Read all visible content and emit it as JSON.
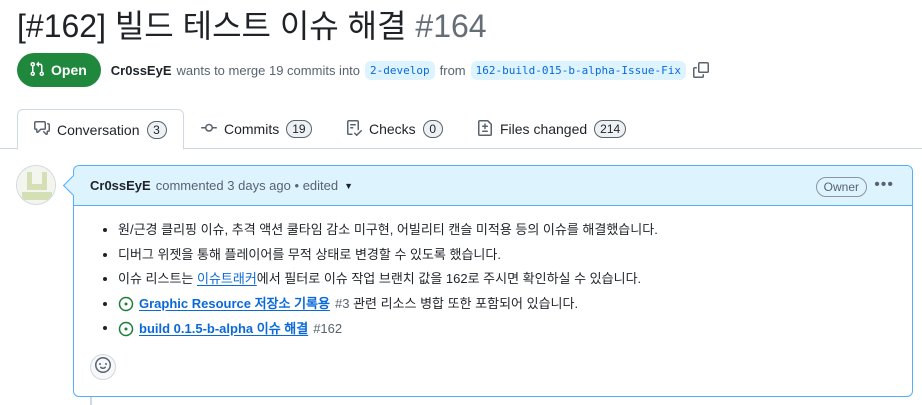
{
  "pr": {
    "title": "[#162] 빌드 테스트 이슈 해결",
    "number": "#164",
    "state": "Open",
    "author": "Cr0ssEyE",
    "merge_text_1": "wants to merge 19 commits into",
    "base_branch": "2-develop",
    "merge_text_2": "from",
    "head_branch": "162-build-015-b-alpha-Issue-Fix"
  },
  "tabs": [
    {
      "label": "Conversation",
      "count": "3",
      "icon": "comment-discussion-icon"
    },
    {
      "label": "Commits",
      "count": "19",
      "icon": "git-commit-icon"
    },
    {
      "label": "Checks",
      "count": "0",
      "icon": "checklist-icon"
    },
    {
      "label": "Files changed",
      "count": "214",
      "icon": "file-diff-icon"
    }
  ],
  "comment": {
    "author": "Cr0ssEyE",
    "action": "commented",
    "time": "3 days ago",
    "separator": "•",
    "edited": "edited",
    "badge": "Owner",
    "more": "•••",
    "items": [
      {
        "text": "원/근경 클리핑 이슈, 추격 액션 쿨타임 감소 미구현, 어빌리티 캔슬 미적용 등의 이슈를 해결했습니다."
      },
      {
        "text": "디버그 위젯을 통해 플레이어를 무적 상태로 변경할 수 있도록 했습니다."
      },
      {
        "pre": "이슈 리스트는 ",
        "link": "이슈트래커",
        "post": "에서 필터로 이슈 작업 브랜치 값을 162로 주시면 확인하실 수 있습니다."
      },
      {
        "issue_title": "Graphic Resource 저장소 기록용",
        "issue_num": "#3",
        "post": " 관련 리소스 병합 또한 포함되어 있습니다."
      },
      {
        "issue_title": "build 0.1.5-b-alpha 이슈 해결",
        "issue_num": "#162"
      }
    ]
  },
  "colors": {
    "open_green": "#1f883d",
    "link_blue": "#0969da",
    "header_bg": "#ddf4ff",
    "border_blue": "#54aeff"
  }
}
